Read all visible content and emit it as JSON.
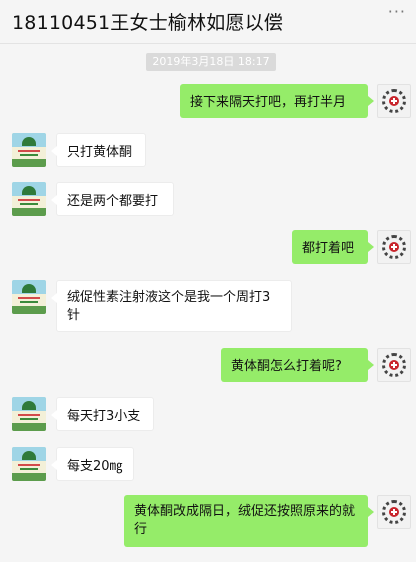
{
  "header": {
    "title": "18110451王女士榆林如愿以偿",
    "more_icon": "more-dots-icon"
  },
  "timestamp": "2019年3月18日 18:17",
  "messages": [
    {
      "side": "right",
      "text": "接下来隔天打吧，再打半月"
    },
    {
      "side": "left",
      "text": "只打黄体酮"
    },
    {
      "side": "left",
      "text": "还是两个都要打"
    },
    {
      "side": "right",
      "text": "都打着吧"
    },
    {
      "side": "left",
      "text": "绒促性素注射液这个是我一个周打3针"
    },
    {
      "side": "right",
      "text": "黄体酮怎么打着呢?"
    },
    {
      "side": "left",
      "text": "每天打3小支"
    },
    {
      "side": "left",
      "text": "每支20㎎"
    },
    {
      "side": "right",
      "text": "黄体酮改成隔日，绒促还按照原来的就行"
    }
  ],
  "colors": {
    "self_bubble": "#95ec69",
    "other_bubble": "#ffffff",
    "background": "#f5f5f5"
  }
}
